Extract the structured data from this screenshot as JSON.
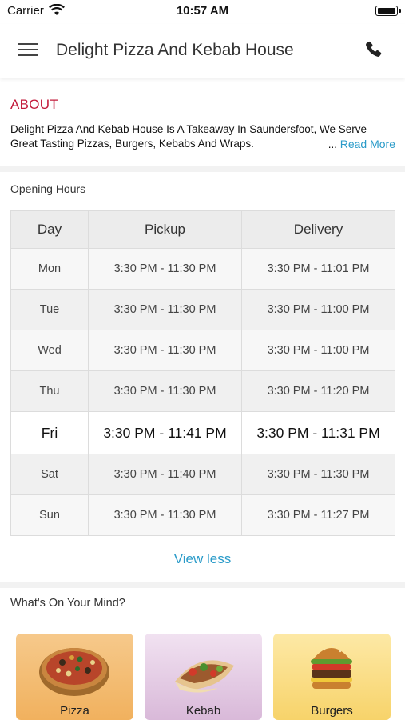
{
  "status_bar": {
    "carrier": "Carrier",
    "time": "10:57 AM"
  },
  "header": {
    "title": "Delight Pizza And Kebab House",
    "menu_icon": "hamburger-menu-icon",
    "phone_icon": "phone-icon"
  },
  "about": {
    "title": "ABOUT",
    "line1": "Delight Pizza And Kebab House Is A Takeaway In Saundersfoot, We Serve",
    "line2": "Great Tasting Pizzas, Burgers, Kebabs And Wraps.",
    "ellipsis": "...",
    "read_more": "Read More"
  },
  "hours": {
    "title": "Opening Hours",
    "headers": [
      "Day",
      "Pickup",
      "Delivery"
    ],
    "rows": [
      {
        "day": "Mon",
        "pickup": "3:30 PM - 11:30 PM",
        "delivery": "3:30 PM - 11:01 PM"
      },
      {
        "day": "Tue",
        "pickup": "3:30 PM - 11:30 PM",
        "delivery": "3:30 PM - 11:00 PM"
      },
      {
        "day": "Wed",
        "pickup": "3:30 PM - 11:30 PM",
        "delivery": "3:30 PM - 11:00 PM"
      },
      {
        "day": "Thu",
        "pickup": "3:30 PM - 11:30 PM",
        "delivery": "3:30 PM - 11:20 PM"
      },
      {
        "day": "Fri",
        "pickup": "3:30 PM - 11:41 PM",
        "delivery": "3:30 PM - 11:31 PM",
        "today": true
      },
      {
        "day": "Sat",
        "pickup": "3:30 PM - 11:40 PM",
        "delivery": "3:30 PM - 11:30 PM"
      },
      {
        "day": "Sun",
        "pickup": "3:30 PM - 11:30 PM",
        "delivery": "3:30 PM - 11:27 PM"
      }
    ],
    "view_less": "View less"
  },
  "categories": {
    "title": "What's On Your Mind?",
    "items": [
      {
        "label": "Pizza",
        "icon": "pizza-image"
      },
      {
        "label": "Kebab",
        "icon": "kebab-image"
      },
      {
        "label": "Burgers",
        "icon": "burger-image"
      }
    ]
  },
  "colors": {
    "accent_red": "#c2193a",
    "link_blue": "#2a9bc9"
  }
}
